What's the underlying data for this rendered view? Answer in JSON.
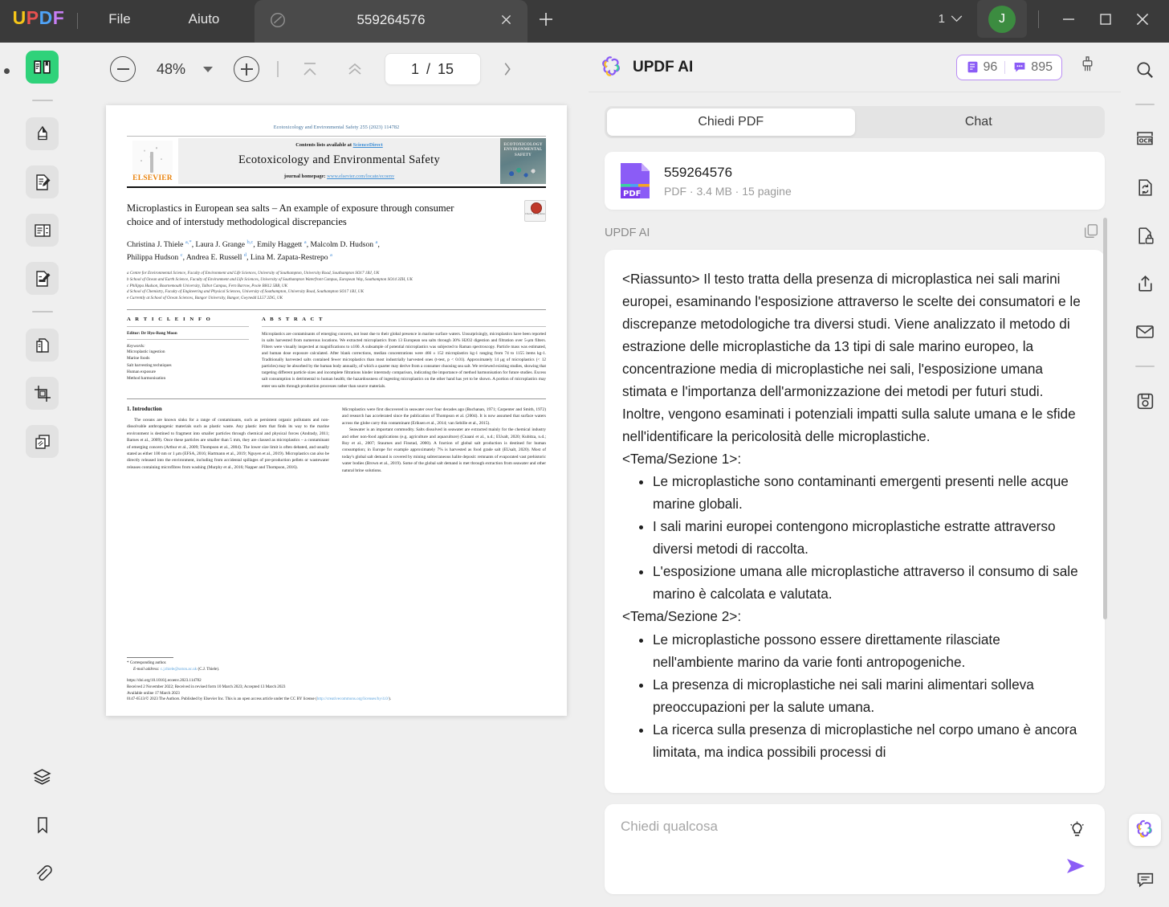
{
  "titlebar": {
    "logo": "UPDF",
    "menus": [
      "File",
      "Aiuto"
    ],
    "tab_title": "559264576",
    "tab_icon": "document-slash-icon",
    "new_tab_icon": "plus-icon",
    "window_count": "1",
    "avatar_initial": "J",
    "minimize_icon": "minimize-icon",
    "maximize_icon": "maximize-icon",
    "close_icon": "close-icon"
  },
  "left_rail": {
    "items": [
      {
        "name": "reader-icon",
        "label": "Lettore",
        "active": true
      },
      {
        "name": "highlighter-icon",
        "label": "Evidenziatore"
      },
      {
        "name": "edit-document-icon",
        "label": "Modifica PDF"
      },
      {
        "name": "page-layout-icon",
        "label": "Organizza pagine"
      },
      {
        "name": "form-edit-icon",
        "label": "Modulo"
      },
      {
        "name": "convert-document-icon",
        "label": "Converti"
      },
      {
        "name": "crop-icon",
        "label": "Ritaglia"
      },
      {
        "name": "compare-pages-icon",
        "label": "Confronta"
      },
      {
        "name": "layers-icon",
        "label": "Livelli"
      },
      {
        "name": "bookmark-icon",
        "label": "Segnalibri"
      },
      {
        "name": "attachment-icon",
        "label": "Allegati"
      }
    ]
  },
  "right_rail": {
    "items": [
      {
        "name": "search-icon",
        "label": "Cerca"
      },
      {
        "name": "ocr-icon",
        "label": "OCR"
      },
      {
        "name": "convert-file-icon",
        "label": "Converti file"
      },
      {
        "name": "protect-document-icon",
        "label": "Proteggi"
      },
      {
        "name": "share-icon",
        "label": "Condividi"
      },
      {
        "name": "mail-icon",
        "label": "Email"
      },
      {
        "name": "save-icon",
        "label": "Salva"
      },
      {
        "name": "updf-ai-icon",
        "label": "UPDF AI"
      },
      {
        "name": "feedback-icon",
        "label": "Feedback"
      }
    ]
  },
  "viewer_toolbar": {
    "zoom_out_icon": "zoom-out-icon",
    "zoom_level": "48%",
    "zoom_dropdown_icon": "chevron-down-icon",
    "zoom_in_icon": "zoom-in-icon",
    "first_page_icon": "first-page-icon",
    "prev_page_icon": "prev-page-icon",
    "current_page": "1",
    "page_separator": "/",
    "total_pages": "15",
    "collapse_icon": "collapse-panel-icon"
  },
  "pdf_page": {
    "journal_header": "Ecotoxicology and Environmental Safety 255 (2023) 114782",
    "contents_prefix": "Contents lists available at",
    "contents_link": "ScienceDirect",
    "journal_title": "Ecotoxicology and Environmental Safety",
    "homepage_prefix": "journal homepage:",
    "homepage_link": "www.elsevier.com/locate/ecoenv",
    "publisher": "ELSEVIER",
    "cover_text": "ECOTOXICOLOGY ENVIRONMENTAL SAFETY",
    "check_updates": "Check for updates",
    "article_title": "Microplastics in European sea salts – An example of exposure through consumer choice and of interstudy methodological discrepancies",
    "authors": "Christina J. Thiele a,*, Laura J. Grange b,c, Emily Haggett a, Malcolm D. Hudson a, Philippa Hudson c, Andrea E. Russell d, Lina M. Zapata-Restrepo a",
    "affiliations": [
      "a Centre for Environmental Science, Faculty of Environment and Life Sciences, University of Southampton, University Road, Southampton SO17 1BJ, UK",
      "b School of Ocean and Earth Science, Faculty of Environment and Life Sciences, University of Southampton Waterfront Campus, European Way, Southampton SO14 3ZH, UK",
      "c Philippa Hudson, Bournemouth University, Talbot Campus, Fern Barrow, Poole BH12 5BB, UK",
      "d School of Chemistry, Faculty of Engineering and Physical Sciences, University of Southampton, University Road, Southampton SO17 1BJ, UK",
      "e Currently at School of Ocean Sciences, Bangor University, Bangor, Gwynedd LL57 2DG, UK"
    ],
    "article_info_heading": "A R T I C L E   I N F O",
    "abstract_heading": "A B S T R A C T",
    "editor": "Editor: Dr Hyo-Bang Moon",
    "keywords_label": "Keywords:",
    "keywords": [
      "Microplastic ingestion",
      "Marine foods",
      "Salt harvesting techniques",
      "Human exposure",
      "Method harmonisation"
    ],
    "abstract_text": "Microplastics are contaminants of emerging concern, not least due to their global presence in marine surface waters. Unsurprisingly, microplastics have been reported in salts harvested from numerous locations. We extracted microplastics from 13 European sea salts through 30% H2O2 digestion and filtration over 5-μm filters. Filters were visually inspected at magnifications to x100. A subsample of potential microplastics was subjected to Raman spectroscopy. Particle mass was estimated, and human dose exposure calculated. After blank corrections, median concentrations were 466 ± 152 microplastics kg-1 ranging from 74 to 1155 items kg-1. Traditionally harvested salts contained fewer microplastics than most industrially harvested ones (t-test, p < 0.01). Approximately 14 μg of microplastics (< 12 particles) may be absorbed by the human body annually, of which a quarter may derive from a consumer choosing sea salt. We reviewed existing studies, showing that targeting different particle sizes and incomplete filtrations hinder interstudy comparison, indicating the importance of method harmonisation for future studies. Excess salt consumption is detrimental to human health; the hazardousness of ingesting microplastics on the other hand has yet to be shown. A portion of microplastics may enter sea salts through production processes rather than source materials.",
    "intro_heading": "1.  Introduction",
    "intro_col1": "The oceans are known sinks for a range of contaminants, such as persistent organic pollutants and non-dissolvable anthropogenic materials such as plastic waste. Any plastic item that finds its way to the marine environment is destined to fragment into smaller particles through chemical and physical forces (Andrady, 2011; Barnes et al., 2009). Once these particles are smaller than 5 mm, they are classed as microplastics – a contaminant of emerging concern (Arthur et al., 2009; Thompson et al., 2004). The lower size limit is often debated, and usually stated as either 100 nm or 1 μm (EFSA, 2016; Hartmann et al., 2019; Nguyen et al., 2019). Microplastics can also be directly released into the environment, including from accidental spillages of pre-production pellets or wastewater releases containing microfibres from washing (Murphy et al., 2016; Napper and Thompson, 2016).",
    "intro_col2": "Microplastics were first discovered in seawater over four decades ago (Buchanan, 1971; Carpenter and Smith, 1972) and research has accelerated since the publication of Thompson et al. (2004). It is now assumed that surface waters across the globe carry this contaminant (Eriksen et al., 2014; van Sebille et al., 2015).",
    "intro_col2b": "Seawater is an important commodity. Salts dissolved in seawater are extracted mainly for the chemical industry and other non-food applications (e.g. agriculture and aquaculture) (Cnaani et al., n.d.; EUsalt, 2020; Kubitza, n.d.; Roy et al., 2007; Staurnes and Finstad, 2000). A fraction of global salt production is destined for human consumption; in Europe for example approximately 7% is harvested as food grade salt (EUsalt, 2020). Most of today's global salt demand is covered by mining subterraneous halite deposit: remnants of evaporated vast prehistoric water bodies (Brown et al., 2019). Some of the global salt demand is met through extraction from seawater and other natural brine solutions.",
    "footnote_corresponding": "* Corresponding author.",
    "footnote_email_label": "E-mail address:",
    "footnote_email": "c.j.thiele@soton.ac.uk",
    "footnote_email_suffix": "(C.J. Thiele).",
    "doi": "https://doi.org/10.1016/j.ecoenv.2023.114782",
    "received": "Received 2 November 2022; Received in revised form 10 March 2023; Accepted 13 March 2023",
    "available": "Available online 17 March 2023",
    "license_prefix": "0147-6513/© 2023 The Authors. Published by Elsevier Inc. This is an open access article under the CC BY license (",
    "license_link": "http://creativecommons.org/licenses/by/4.0/",
    "license_suffix": ")."
  },
  "ai_panel": {
    "logo_icon": "updf-ai-flower-icon",
    "title": "UPDF AI",
    "credits": {
      "doc_icon": "document-credit-icon",
      "doc_count": "96",
      "chat_icon": "chat-credit-icon",
      "chat_count": "895"
    },
    "clean_icon": "clear-brush-icon",
    "tabs": [
      {
        "label": "Chiedi PDF",
        "active": true
      },
      {
        "label": "Chat",
        "active": false
      }
    ],
    "document": {
      "icon": "pdf-file-icon",
      "badge": "PDF",
      "name": "559264576",
      "meta": "PDF · 3.4 MB · 15 pagine"
    },
    "message": {
      "sender": "UPDF AI",
      "copy_icon": "copy-icon",
      "summary_tag": "<Riassunto>",
      "summary_text": " Il testo tratta della presenza di microplastica nei sali marini europei, esaminando l'esposizione attraverso le scelte dei consumatori e le discrepanze metodologiche tra diversi studi. Viene analizzato il metodo di estrazione delle microplastiche da 13 tipi di sale marino europeo, la concentrazione media di microplastiche nei sali, l'esposizione umana stimata e l'importanza dell'armonizzazione dei metodi per futuri studi. Inoltre, vengono esaminati i potenziali impatti sulla salute umana e le sfide nell'identificare la pericolosità delle microplastiche.",
      "section1_heading": "<Tema/Sezione 1>:",
      "section1_bullets": [
        "Le microplastiche sono contaminanti emergenti presenti nelle acque marine globali.",
        "I sali marini europei contengono microplastiche estratte attraverso diversi metodi di raccolta.",
        "L'esposizione umana alle microplastiche attraverso il consumo di sale marino è calcolata e valutata."
      ],
      "section2_heading": "<Tema/Sezione 2>:",
      "section2_bullets": [
        "Le microplastiche possono essere direttamente rilasciate nell'ambiente marino da varie fonti antropogeniche.",
        "La presenza di microplastiche nei sali marini alimentari solleva preoccupazioni per la salute umana.",
        "La ricerca sulla presenza di microplastiche nel corpo umano è ancora limitata, ma indica possibili processi di"
      ]
    },
    "input": {
      "placeholder": "Chiedi qualcosa",
      "value": "",
      "bulb_icon": "lightbulb-icon",
      "send_icon": "send-icon"
    }
  },
  "colors": {
    "titlebar_bg": "#3a3a3a",
    "app_bg": "#efefef",
    "accent_purple": "#8b5cf6",
    "accent_green": "#2fd27a",
    "avatar_green": "#3c8c40"
  }
}
